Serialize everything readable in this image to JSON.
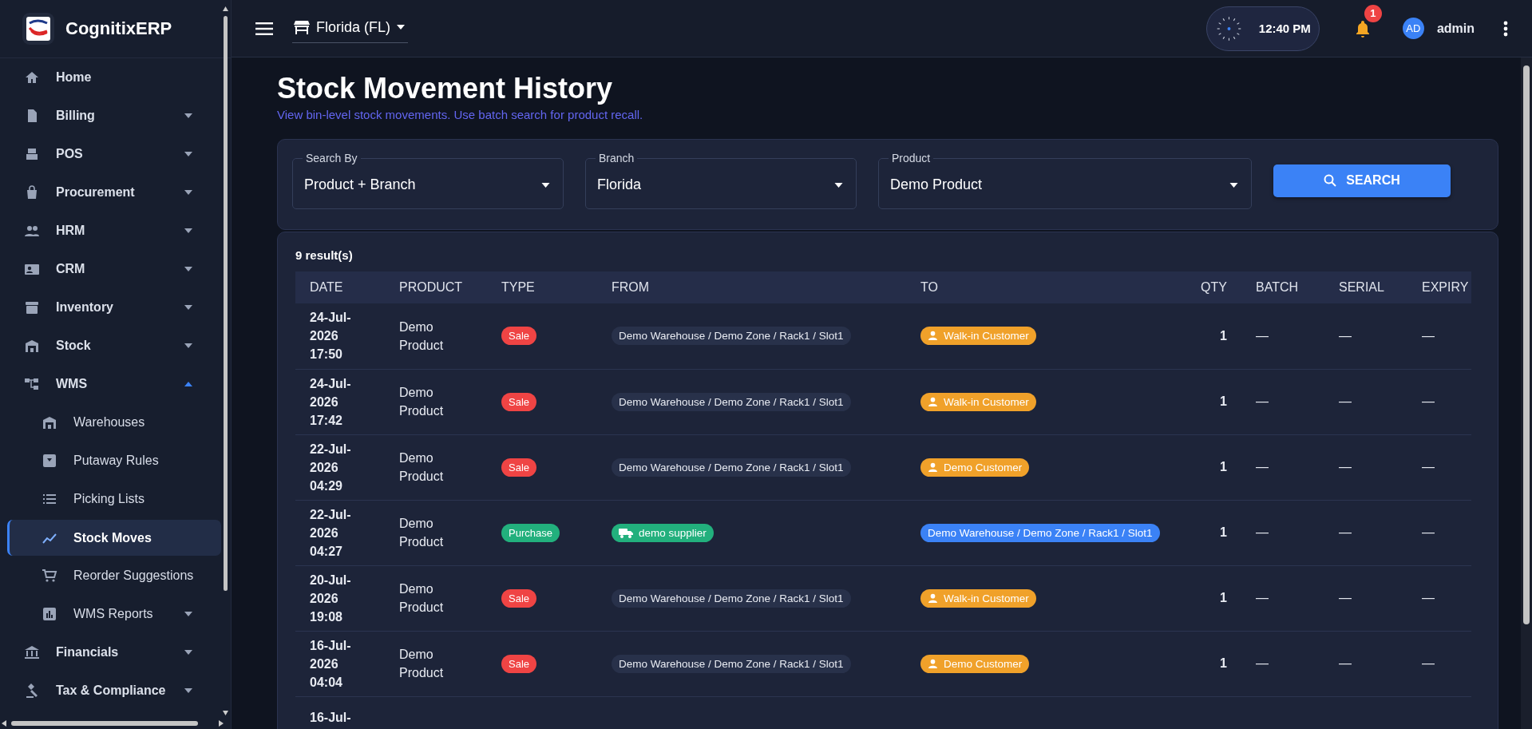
{
  "sidebar": {
    "brand": "CognitixERP",
    "items": [
      {
        "label": "Home",
        "kind": "link",
        "selected": false
      },
      {
        "label": "Billing",
        "kind": "group",
        "expanded": false,
        "selected": false
      },
      {
        "label": "POS",
        "kind": "group",
        "expanded": false,
        "selected": false
      },
      {
        "label": "Procurement",
        "kind": "group",
        "expanded": false,
        "selected": false
      },
      {
        "label": "HRM",
        "kind": "group",
        "expanded": false,
        "selected": false
      },
      {
        "label": "CRM",
        "kind": "group",
        "expanded": false,
        "selected": false
      },
      {
        "label": "Inventory",
        "kind": "group",
        "expanded": false,
        "selected": false
      },
      {
        "label": "Stock",
        "kind": "group",
        "expanded": false,
        "selected": false
      },
      {
        "label": "WMS",
        "kind": "group",
        "expanded": true,
        "selected": false,
        "children": [
          {
            "label": "Warehouses",
            "kind": "link",
            "selected": false
          },
          {
            "label": "Putaway Rules",
            "kind": "link",
            "selected": false
          },
          {
            "label": "Picking Lists",
            "kind": "link",
            "selected": false
          },
          {
            "label": "Stock Moves",
            "kind": "link",
            "selected": true
          },
          {
            "label": "Reorder Suggestions",
            "kind": "link",
            "selected": false
          },
          {
            "label": "WMS Reports",
            "kind": "group",
            "expanded": false,
            "selected": false
          }
        ]
      },
      {
        "label": "Financials",
        "kind": "group",
        "expanded": false,
        "selected": false
      },
      {
        "label": "Tax & Compliance",
        "kind": "group",
        "expanded": false,
        "selected": false
      }
    ]
  },
  "topbar": {
    "branch": "Florida (FL)",
    "clock": "12:40 PM",
    "notifications": "1",
    "avatar": "AD",
    "user": "admin"
  },
  "page": {
    "title": "Stock Movement History",
    "subtitle": "View bin-level stock movements. Use batch search for product recall."
  },
  "filters": {
    "fields": [
      {
        "label": "Search By",
        "value": "Product + Branch"
      },
      {
        "label": "Branch",
        "value": "Florida"
      },
      {
        "label": "Product",
        "value": "Demo Product"
      }
    ],
    "button": "SEARCH"
  },
  "results": {
    "count": "9 result(s)",
    "columns": [
      "DATE",
      "PRODUCT",
      "TYPE",
      "FROM",
      "TO",
      "QTY",
      "BATCH",
      "SERIAL",
      "EXPIRY"
    ],
    "rows": [
      {
        "date": "24-Jul-2026 17:50",
        "product": "Demo Product",
        "type": {
          "label": "Sale",
          "kind": "sale"
        },
        "from": {
          "label": "Demo Warehouse / Demo Zone / Rack1 / Slot1",
          "kind": "source_bin"
        },
        "to": {
          "label": "Walk-in Customer",
          "kind": "customer"
        },
        "qty": "1",
        "batch": "—",
        "serial": "—",
        "expiry": "—"
      },
      {
        "date": "24-Jul-2026 17:42",
        "product": "Demo Product",
        "type": {
          "label": "Sale",
          "kind": "sale"
        },
        "from": {
          "label": "Demo Warehouse / Demo Zone / Rack1 / Slot1",
          "kind": "source_bin"
        },
        "to": {
          "label": "Walk-in Customer",
          "kind": "customer"
        },
        "qty": "1",
        "batch": "—",
        "serial": "—",
        "expiry": "—"
      },
      {
        "date": "22-Jul-2026 04:29",
        "product": "Demo Product",
        "type": {
          "label": "Sale",
          "kind": "sale"
        },
        "from": {
          "label": "Demo Warehouse / Demo Zone / Rack1 / Slot1",
          "kind": "source_bin"
        },
        "to": {
          "label": "Demo Customer",
          "kind": "customer"
        },
        "qty": "1",
        "batch": "—",
        "serial": "—",
        "expiry": "—"
      },
      {
        "date": "22-Jul-2026 04:27",
        "product": "Demo Product",
        "type": {
          "label": "Purchase",
          "kind": "purchase"
        },
        "from": {
          "label": "demo supplier",
          "kind": "supplier"
        },
        "to": {
          "label": "Demo Warehouse / Demo Zone / Rack1 / Slot1",
          "kind": "target_bin"
        },
        "qty": "1",
        "batch": "—",
        "serial": "—",
        "expiry": "—"
      },
      {
        "date": "20-Jul-2026 19:08",
        "product": "Demo Product",
        "type": {
          "label": "Sale",
          "kind": "sale"
        },
        "from": {
          "label": "Demo Warehouse / Demo Zone / Rack1 / Slot1",
          "kind": "source_bin"
        },
        "to": {
          "label": "Walk-in Customer",
          "kind": "customer"
        },
        "qty": "1",
        "batch": "—",
        "serial": "—",
        "expiry": "—"
      },
      {
        "date": "16-Jul-2026 04:04",
        "product": "Demo Product",
        "type": {
          "label": "Sale",
          "kind": "sale"
        },
        "from": {
          "label": "Demo Warehouse / Demo Zone / Rack1 / Slot1",
          "kind": "source_bin"
        },
        "to": {
          "label": "Demo Customer",
          "kind": "customer"
        },
        "qty": "1",
        "batch": "—",
        "serial": "—",
        "expiry": "—"
      },
      {
        "date": "16-Jul-"
      }
    ]
  }
}
